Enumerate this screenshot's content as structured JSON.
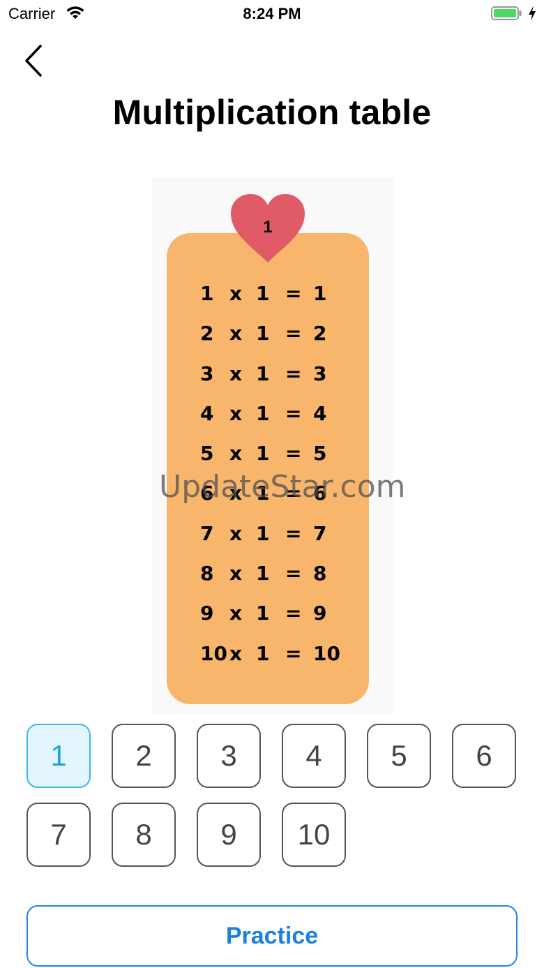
{
  "status_bar": {
    "carrier": "Carrier",
    "time": "8:24 PM"
  },
  "header": {
    "title": "Multiplication table"
  },
  "table": {
    "number": "1",
    "rows": [
      {
        "a": "1",
        "op": "x",
        "b": "1",
        "eq": "=",
        "r": "1"
      },
      {
        "a": "2",
        "op": "x",
        "b": "1",
        "eq": "=",
        "r": "2"
      },
      {
        "a": "3",
        "op": "x",
        "b": "1",
        "eq": "=",
        "r": "3"
      },
      {
        "a": "4",
        "op": "x",
        "b": "1",
        "eq": "=",
        "r": "4"
      },
      {
        "a": "5",
        "op": "x",
        "b": "1",
        "eq": "=",
        "r": "5"
      },
      {
        "a": "6",
        "op": "x",
        "b": "1",
        "eq": "=",
        "r": "6"
      },
      {
        "a": "7",
        "op": "x",
        "b": "1",
        "eq": "=",
        "r": "7"
      },
      {
        "a": "8",
        "op": "x",
        "b": "1",
        "eq": "=",
        "r": "8"
      },
      {
        "a": "9",
        "op": "x",
        "b": "1",
        "eq": "=",
        "r": "9"
      },
      {
        "a": "10",
        "op": "x",
        "b": "1",
        "eq": "=",
        "r": "10"
      }
    ]
  },
  "watermark": "UpdateStar.com",
  "number_buttons": [
    {
      "label": "1",
      "active": true
    },
    {
      "label": "2",
      "active": false
    },
    {
      "label": "3",
      "active": false
    },
    {
      "label": "4",
      "active": false
    },
    {
      "label": "5",
      "active": false
    },
    {
      "label": "6",
      "active": false
    },
    {
      "label": "7",
      "active": false
    },
    {
      "label": "8",
      "active": false
    },
    {
      "label": "9",
      "active": false
    },
    {
      "label": "10",
      "active": false
    }
  ],
  "practice_label": "Practice",
  "colors": {
    "card": "#f8b56c",
    "heart": "#e05a67",
    "accent": "#1d7fe0",
    "selected": "#1aa3e0"
  }
}
